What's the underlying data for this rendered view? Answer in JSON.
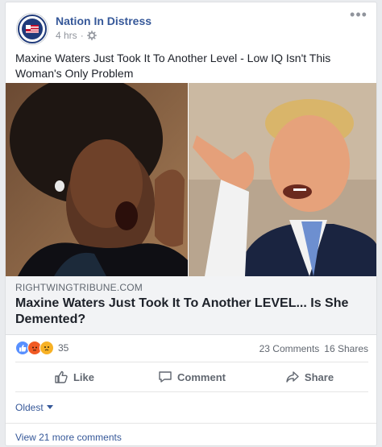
{
  "post": {
    "page_name": "Nation In Distress",
    "time": "4 hrs",
    "separator": "·",
    "text": "Maxine Waters Just Took It To Another Level - Low IQ Isn't This Woman's Only Problem",
    "avatar_text": "NID"
  },
  "link": {
    "domain": "RIGHTWINGTRIBUNE.COM",
    "title": "Maxine Waters Just Took It To Another LEVEL... Is She Demented?"
  },
  "stats": {
    "reaction_count": "35",
    "comments": "23 Comments",
    "shares": "16 Shares",
    "reaction_icons": [
      "like-icon",
      "angry-icon",
      "sad-icon"
    ]
  },
  "actions": {
    "like": "Like",
    "comment": "Comment",
    "share": "Share"
  },
  "comments": {
    "sort_label": "Oldest",
    "view_more": "View 21 more comments"
  },
  "colors": {
    "link_blue": "#365899",
    "like_blue": "#5890ff",
    "angry_orange": "#f15a24",
    "sad_yellow": "#f7b125"
  }
}
